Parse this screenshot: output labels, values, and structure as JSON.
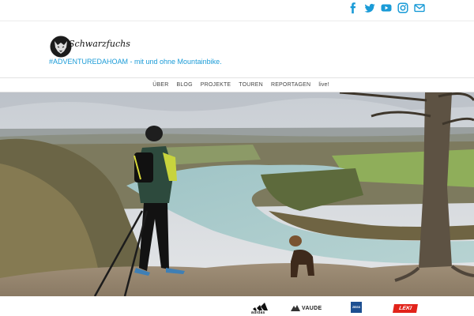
{
  "social": {
    "icons": [
      "facebook-icon",
      "twitter-icon",
      "youtube-icon",
      "instagram-icon",
      "mail-icon"
    ],
    "color": "#1a9bd7"
  },
  "header": {
    "logo_text": "Schwarzfuchs",
    "tagline": "#ADVENTUREDAHOAM - mit und ohne Mountainbike."
  },
  "nav": {
    "items": [
      "ÜBER",
      "BLOG",
      "PROJEKTE",
      "TOUREN",
      "REPORTAGEN",
      "live!"
    ]
  },
  "sponsors": {
    "adidas": "adidas",
    "vaude": "VAUDE",
    "zeiss": "ZEISS",
    "leki": "LEKI",
    "leki_color": "#e2231a",
    "zeiss_color": "#1d4f91"
  },
  "colors": {
    "accent": "#1a9bd7"
  }
}
